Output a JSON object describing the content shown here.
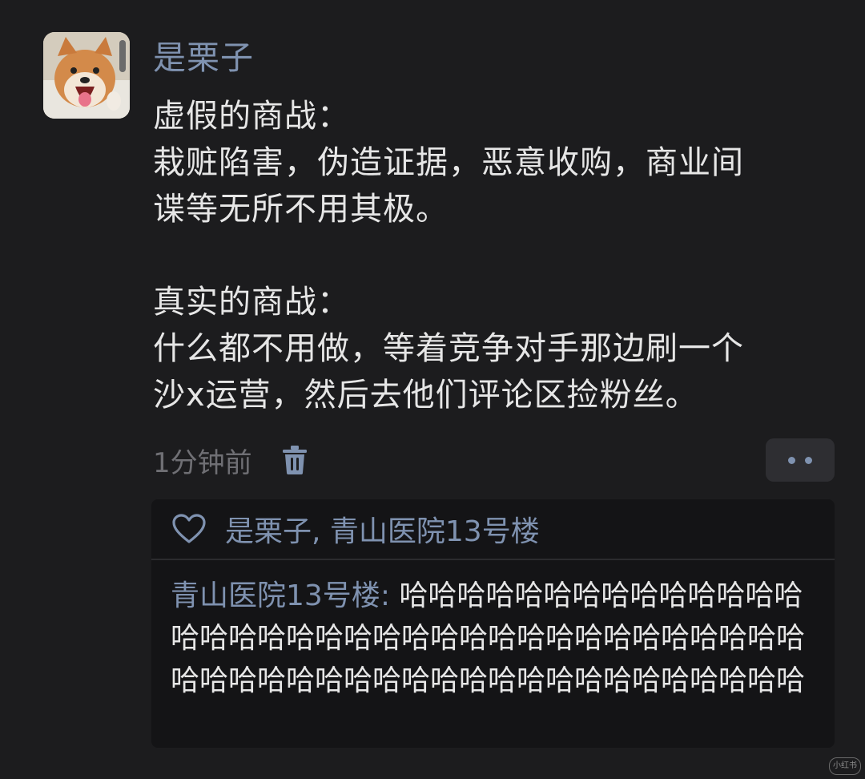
{
  "post": {
    "author": "是栗子",
    "content_lines": [
      "虚假的商战：",
      "栽赃陷害，伪造证据，恶意收购，商业间",
      "谍等无所不用其极。",
      "",
      "真实的商战：",
      "什么都不用做，等着竞争对手那边刷一个",
      "沙x运营，然后去他们评论区捡粉丝。"
    ],
    "time": "1分钟前"
  },
  "icons": {
    "delete": "trash-icon",
    "more": "more-dots-icon",
    "like": "heart-outline-icon"
  },
  "likes": {
    "names": "是栗子, 青山医院13号楼"
  },
  "reply": {
    "author": "青山医院13号楼",
    "separator": ": ",
    "text": "哈哈哈哈哈哈哈哈哈哈哈哈哈哈哈哈哈哈哈哈哈哈哈哈哈哈哈哈哈哈哈哈哈哈哈哈哈哈哈哈哈哈哈哈哈哈哈哈哈哈哈哈哈哈哈哈哈哈"
  },
  "watermark": "小红书",
  "colors": {
    "background": "#1c1c1e",
    "name_link": "#7f92b0",
    "text": "#e6e6e6",
    "muted": "#6f6f74"
  }
}
